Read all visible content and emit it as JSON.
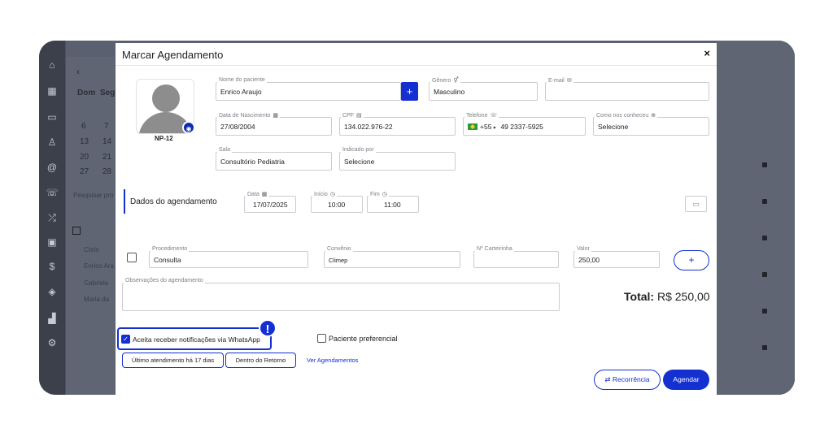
{
  "background": {
    "rail_icons": [
      "home-icon",
      "calendar-icon",
      "inbox-icon",
      "user-icon",
      "at-icon",
      "phone-icon",
      "shuffle-icon",
      "clipboard-icon",
      "dollar-icon",
      "box-icon",
      "chart-icon",
      "gear-icon"
    ],
    "days": [
      "Dom",
      "Seg"
    ],
    "dates": [
      [
        "6",
        "7"
      ],
      [
        "13",
        "14"
      ],
      [
        "20",
        "21"
      ],
      [
        "27",
        "28"
      ]
    ],
    "search_placeholder": "Pesquisar pro",
    "list": [
      "Chris",
      "Enrico Ara",
      "Gabriela",
      "Maria da"
    ]
  },
  "modal": {
    "title": "Marcar Agendamento",
    "close": "×",
    "patient_code": "NP-12",
    "fields": {
      "nome_label": "Nome do paciente",
      "nome_value": "Enrico Araujo",
      "genero_label": "Gênero",
      "genero_value": "Masculino",
      "email_label": "E-mail",
      "email_value": "",
      "nascimento_label": "Data de Nascimento",
      "nascimento_value": "27/08/2004",
      "cpf_label": "CPF",
      "cpf_value": "134.022.976-22",
      "telefone_label": "Telefone",
      "telefone_code": "+55",
      "telefone_value": "49 2337-5925",
      "como_label": "Como nos conheceu",
      "como_value": "Selecione",
      "sala_label": "Sala",
      "sala_value": "Consultório Pediatria",
      "indicado_label": "Indicado por",
      "indicado_value": "Selecione"
    },
    "schedule": {
      "section_title": "Dados do agendamento",
      "data_label": "Data",
      "data_value": "17/07/2025",
      "inicio_label": "Início",
      "inicio_value": "10:00",
      "fim_label": "Fim",
      "fim_value": "11:00"
    },
    "procedure": {
      "procedimento_label": "Procedimento",
      "procedimento_value": "Consulta",
      "convenio_label": "Convênio",
      "convenio_value": "Climep",
      "carteirinha_label": "Nº Carteirinha",
      "carteirinha_value": "",
      "valor_label": "Valor",
      "valor_value": "250,00",
      "add_label": "+"
    },
    "observacoes_label": "Observações do agendamento",
    "total_label": "Total:",
    "total_value": "R$ 250,00",
    "whatsapp_label": "Aceita receber notificações via WhatsApp",
    "whatsapp_checked": true,
    "badge": "!",
    "preferencial_label": "Paciente preferencial",
    "ultimo_label": "Último atendimento há 17 dias",
    "retorno_label": "Dentro do Retorno",
    "ver_label": "Ver Agendamentos",
    "recorrencia_label": "Recorrência",
    "agendar_label": "Agendar",
    "accent_color": "#1430d0"
  }
}
